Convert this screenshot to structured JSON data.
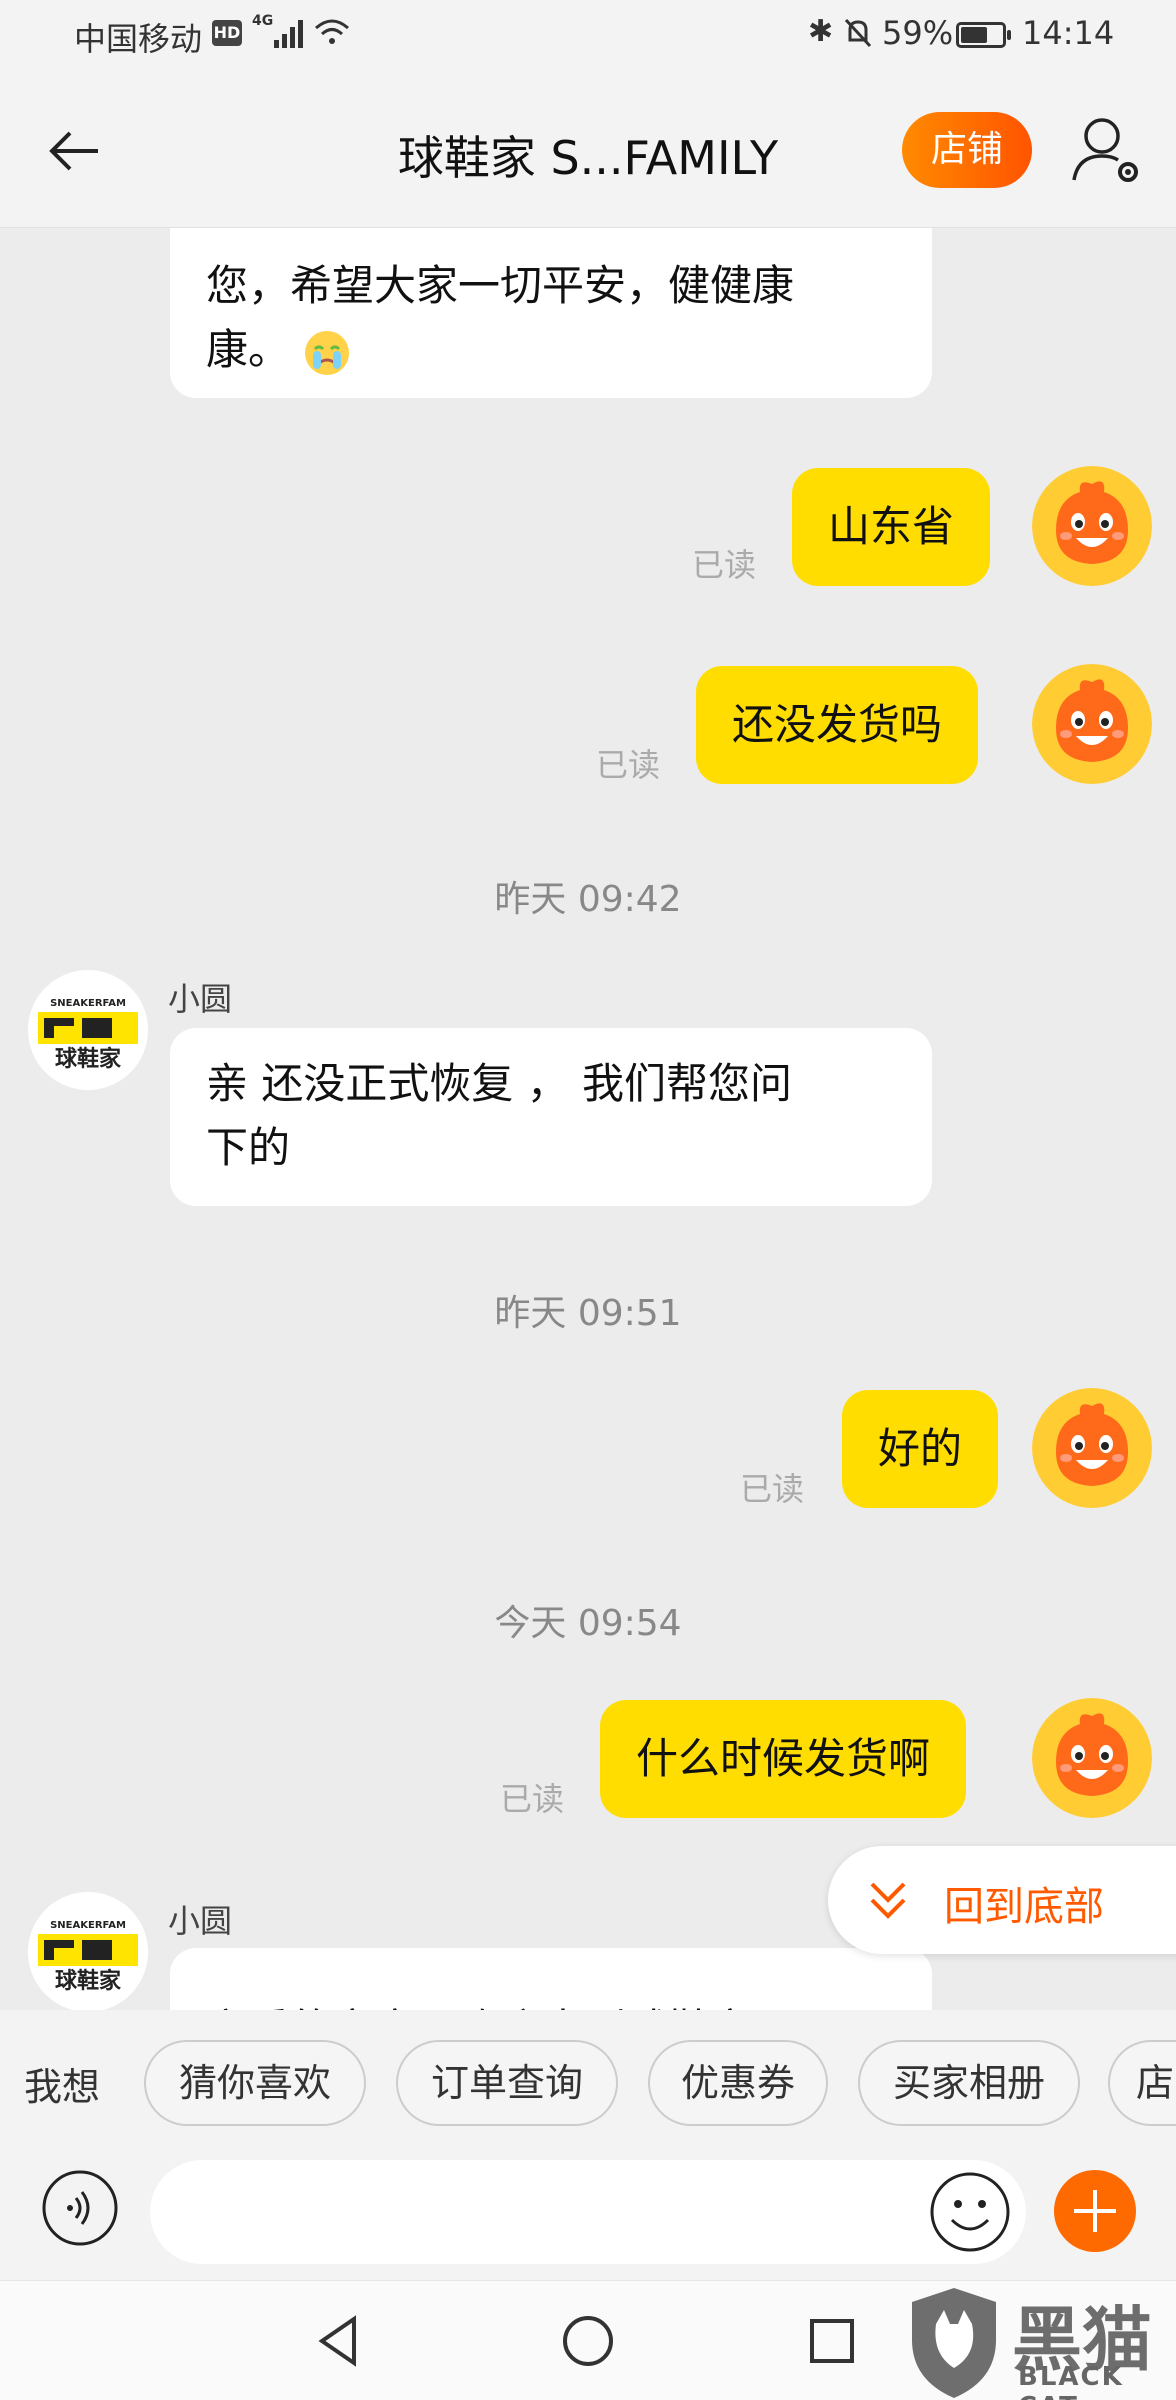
{
  "status_bar": {
    "carrier": "中国移动",
    "hd": "HD",
    "network": "4G",
    "battery": "59%",
    "battery_level": 0.59,
    "time": "14:14"
  },
  "header": {
    "title": "球鞋家 S...FAMILY",
    "shop_button": "店铺",
    "back_icon": "back-arrow-icon",
    "profile_icon": "user-settings-icon"
  },
  "messages": {
    "m0": {
      "text_line1": "您，希望大家一切平安，健健康",
      "text_line2": "康。"
    },
    "m1": {
      "text": "山东省",
      "read": "已读"
    },
    "m2": {
      "text": "还没发货吗",
      "read": "已读"
    },
    "t1": "昨天  09:42",
    "m3": {
      "sender": "小圆",
      "text_line1": "亲 还没正式恢复 ，  我们帮您问",
      "text_line2": "下的"
    },
    "t2": "昨天  09:51",
    "m4": {
      "text": "好的",
      "read": "已读"
    },
    "t3": "今天  09:54",
    "m5": {
      "text": "什么时候发货啊",
      "read": "已读"
    },
    "m6": {
      "sender": "小圆",
      "text_line1": "亲爱的客官，欢迎来到球鞋家"
    }
  },
  "scroll_to_bottom": "回到底部",
  "quick_replies": {
    "prefix": "我想",
    "items": [
      "猜你喜欢",
      "订单查询",
      "优惠券",
      "买家相册",
      "店"
    ]
  },
  "input": {
    "placeholder": ""
  },
  "watermark": {
    "cn": "黑猫",
    "en": "BLACK CAT"
  },
  "colors": {
    "accent": "#ff6a00",
    "bubble_out": "#ffdd00",
    "bubble_in": "#ffffff"
  }
}
